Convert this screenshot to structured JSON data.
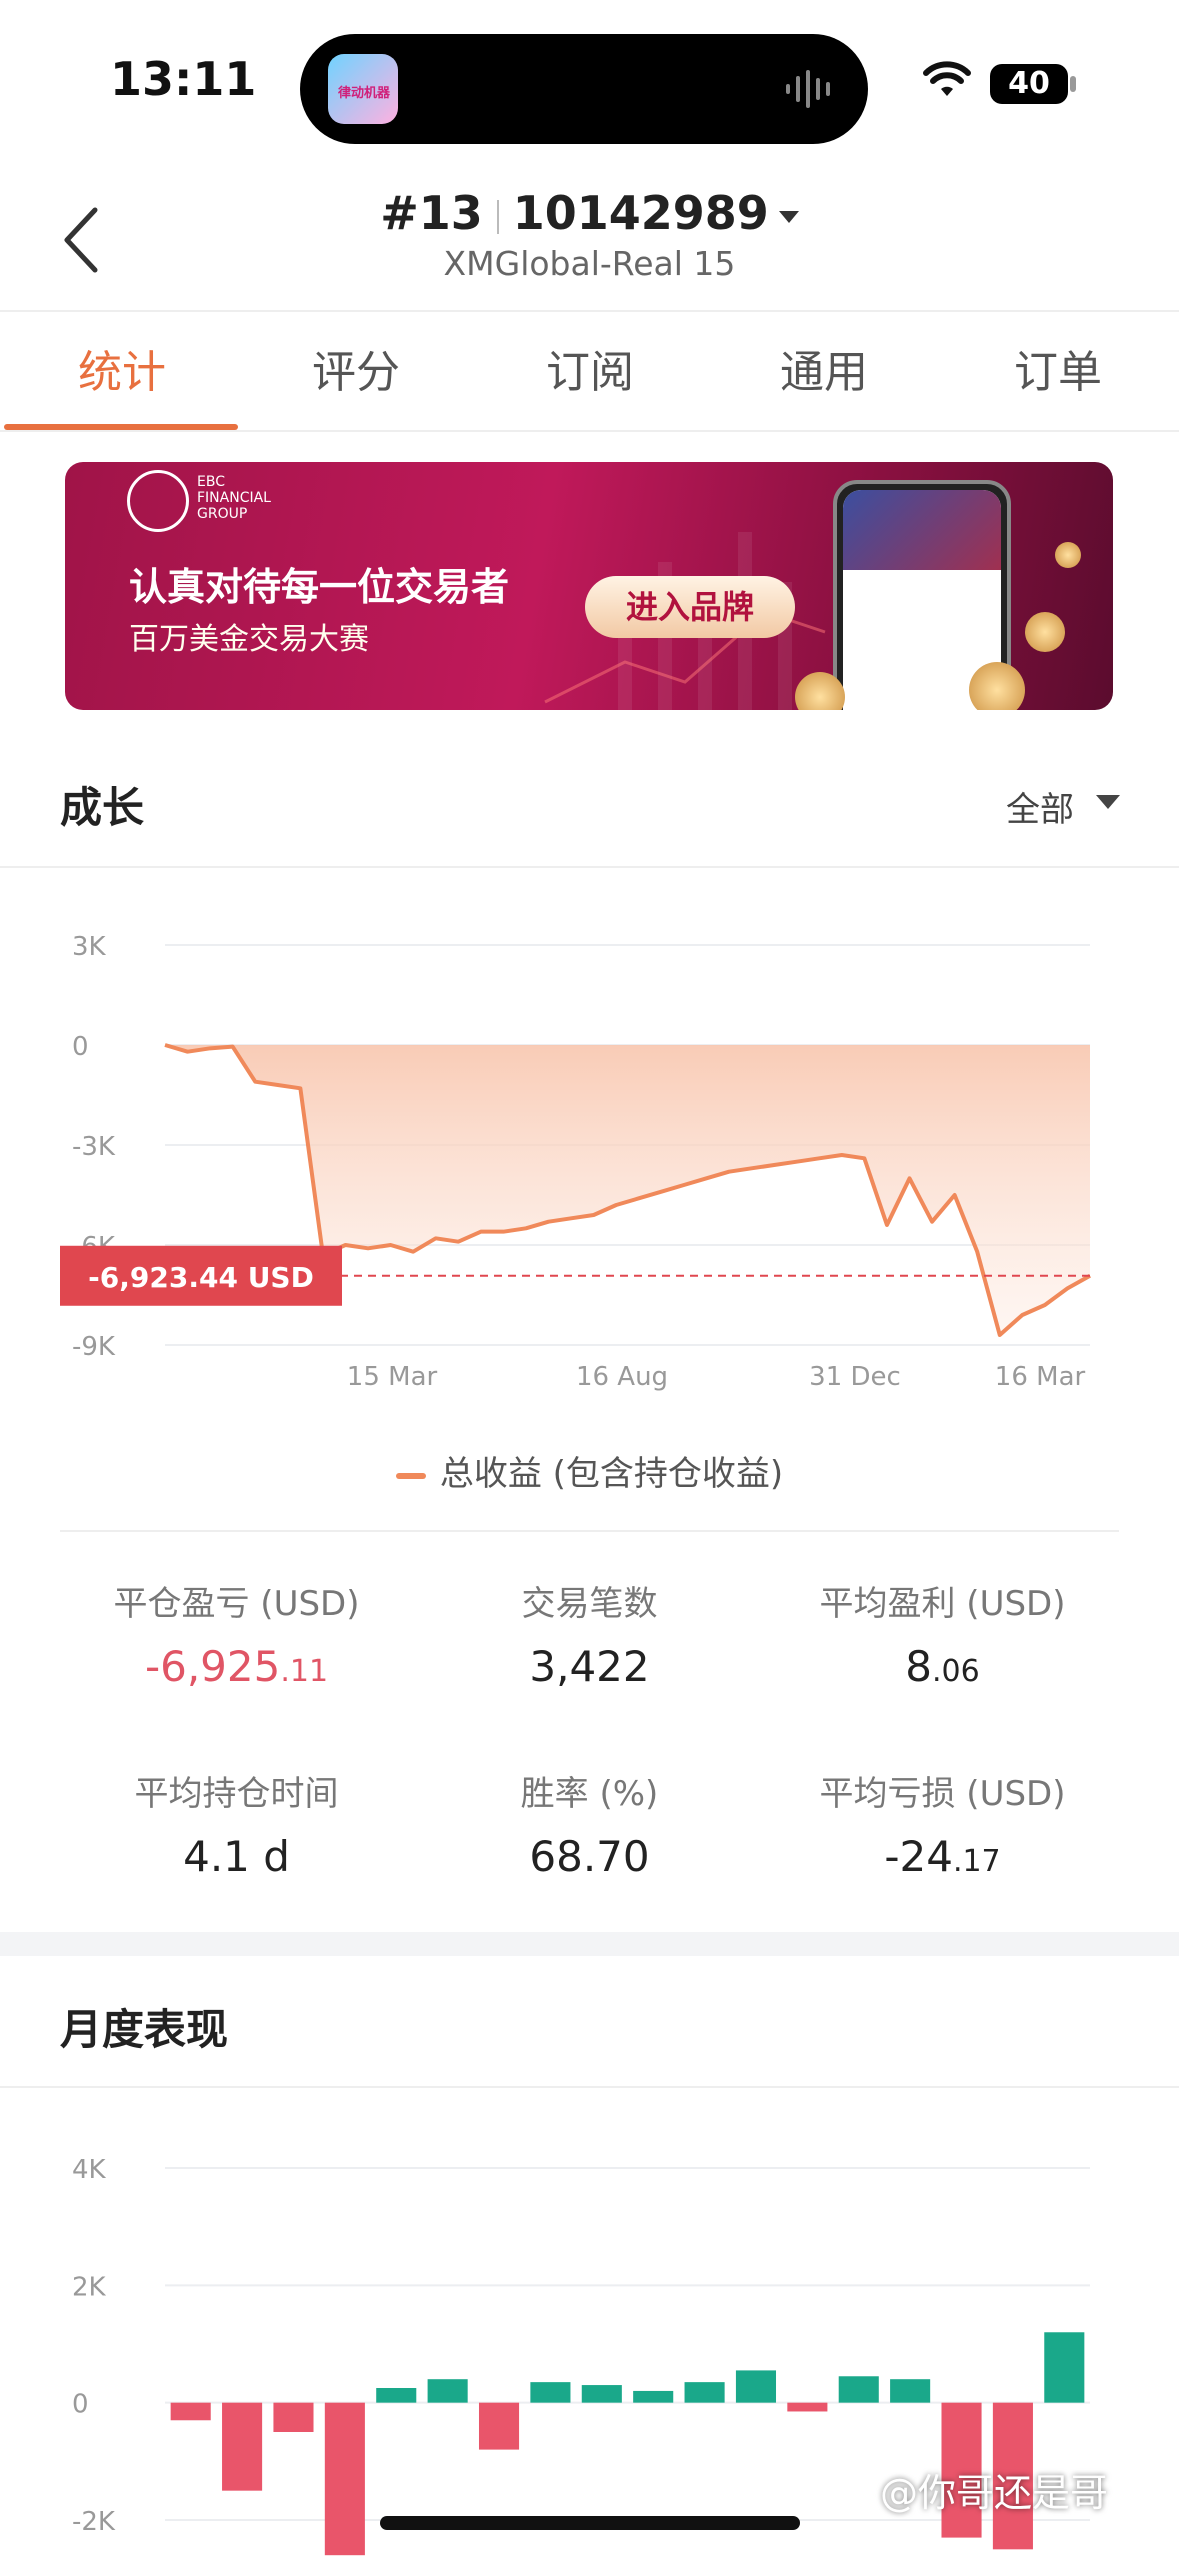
{
  "status_bar": {
    "time": "13:11",
    "battery": "40",
    "app_badge_text": "律动机器"
  },
  "header": {
    "account_number": "#13",
    "account_id": "10142989",
    "server": "XMGlobal-Real 15",
    "back_icon": "chevron-left-icon"
  },
  "tabs": [
    {
      "label": "统计",
      "active": true
    },
    {
      "label": "评分",
      "active": false
    },
    {
      "label": "订阅",
      "active": false
    },
    {
      "label": "通用",
      "active": false
    },
    {
      "label": "订单",
      "active": false
    }
  ],
  "banner": {
    "brand_line1": "EBC",
    "brand_line2": "FINANCIAL",
    "brand_line3": "GROUP",
    "headline": "认真对待每一位交易者",
    "subline": "百万美金交易大赛",
    "button_label": "进入品牌"
  },
  "growth": {
    "title": "成长",
    "filter_label": "全部",
    "legend": "总收益 (包含持仓收益)",
    "current_label": "-6,923.44 USD"
  },
  "chart_data": [
    {
      "type": "area",
      "y_ticks": [
        "3K",
        "0",
        "-3K",
        "-6K",
        "-9K"
      ],
      "x_ticks": [
        "15 Mar",
        "16 Aug",
        "31 Dec",
        "16 Mar"
      ],
      "ylim": [
        -9000,
        3000
      ],
      "series": [
        {
          "name": "总收益 (包含持仓收益)",
          "values": [
            0,
            -200,
            -100,
            -50,
            -1100,
            -1200,
            -1300,
            -6300,
            -6000,
            -6100,
            -6000,
            -6200,
            -5800,
            -5900,
            -5600,
            -5600,
            -5500,
            -5300,
            -5200,
            -5100,
            -4800,
            -4600,
            -4400,
            -4200,
            -4000,
            -3800,
            -3700,
            -3600,
            -3500,
            -3400,
            -3300,
            -3400,
            -5400,
            -4000,
            -5300,
            -4500,
            -6200,
            -8700,
            -8100,
            -7800,
            -7300,
            -6923
          ]
        }
      ],
      "color": "#f0895a"
    },
    {
      "type": "bar",
      "y_ticks": [
        "4K",
        "2K",
        "0",
        "-2K"
      ],
      "ylim": [
        -2000,
        4000
      ],
      "values": [
        -300,
        -1500,
        -500,
        -2600,
        250,
        400,
        -800,
        350,
        300,
        200,
        350,
        550,
        -150,
        450,
        400,
        -2300,
        -2500,
        1200
      ],
      "positive_color": "#1aa88a",
      "negative_color": "#e9556a"
    }
  ],
  "stats": [
    {
      "label": "平仓盈亏 (USD)",
      "value_main": "-6,925",
      "value_frac": ".11",
      "negative": true
    },
    {
      "label": "交易笔数",
      "value_main": "3,422",
      "value_frac": "",
      "negative": false
    },
    {
      "label": "平均盈利 (USD)",
      "value_main": "8",
      "value_frac": ".06",
      "negative": false
    },
    {
      "label": "平均持仓时间",
      "value_main": "4.1 d",
      "value_frac": "",
      "negative": false
    },
    {
      "label": "胜率 (%)",
      "value_main": "68.70",
      "value_frac": "",
      "negative": false
    },
    {
      "label": "平均亏损 (USD)",
      "value_main": "-24",
      "value_frac": ".17",
      "negative": false
    }
  ],
  "monthly": {
    "title": "月度表现"
  },
  "watermark": "@你哥还是哥"
}
